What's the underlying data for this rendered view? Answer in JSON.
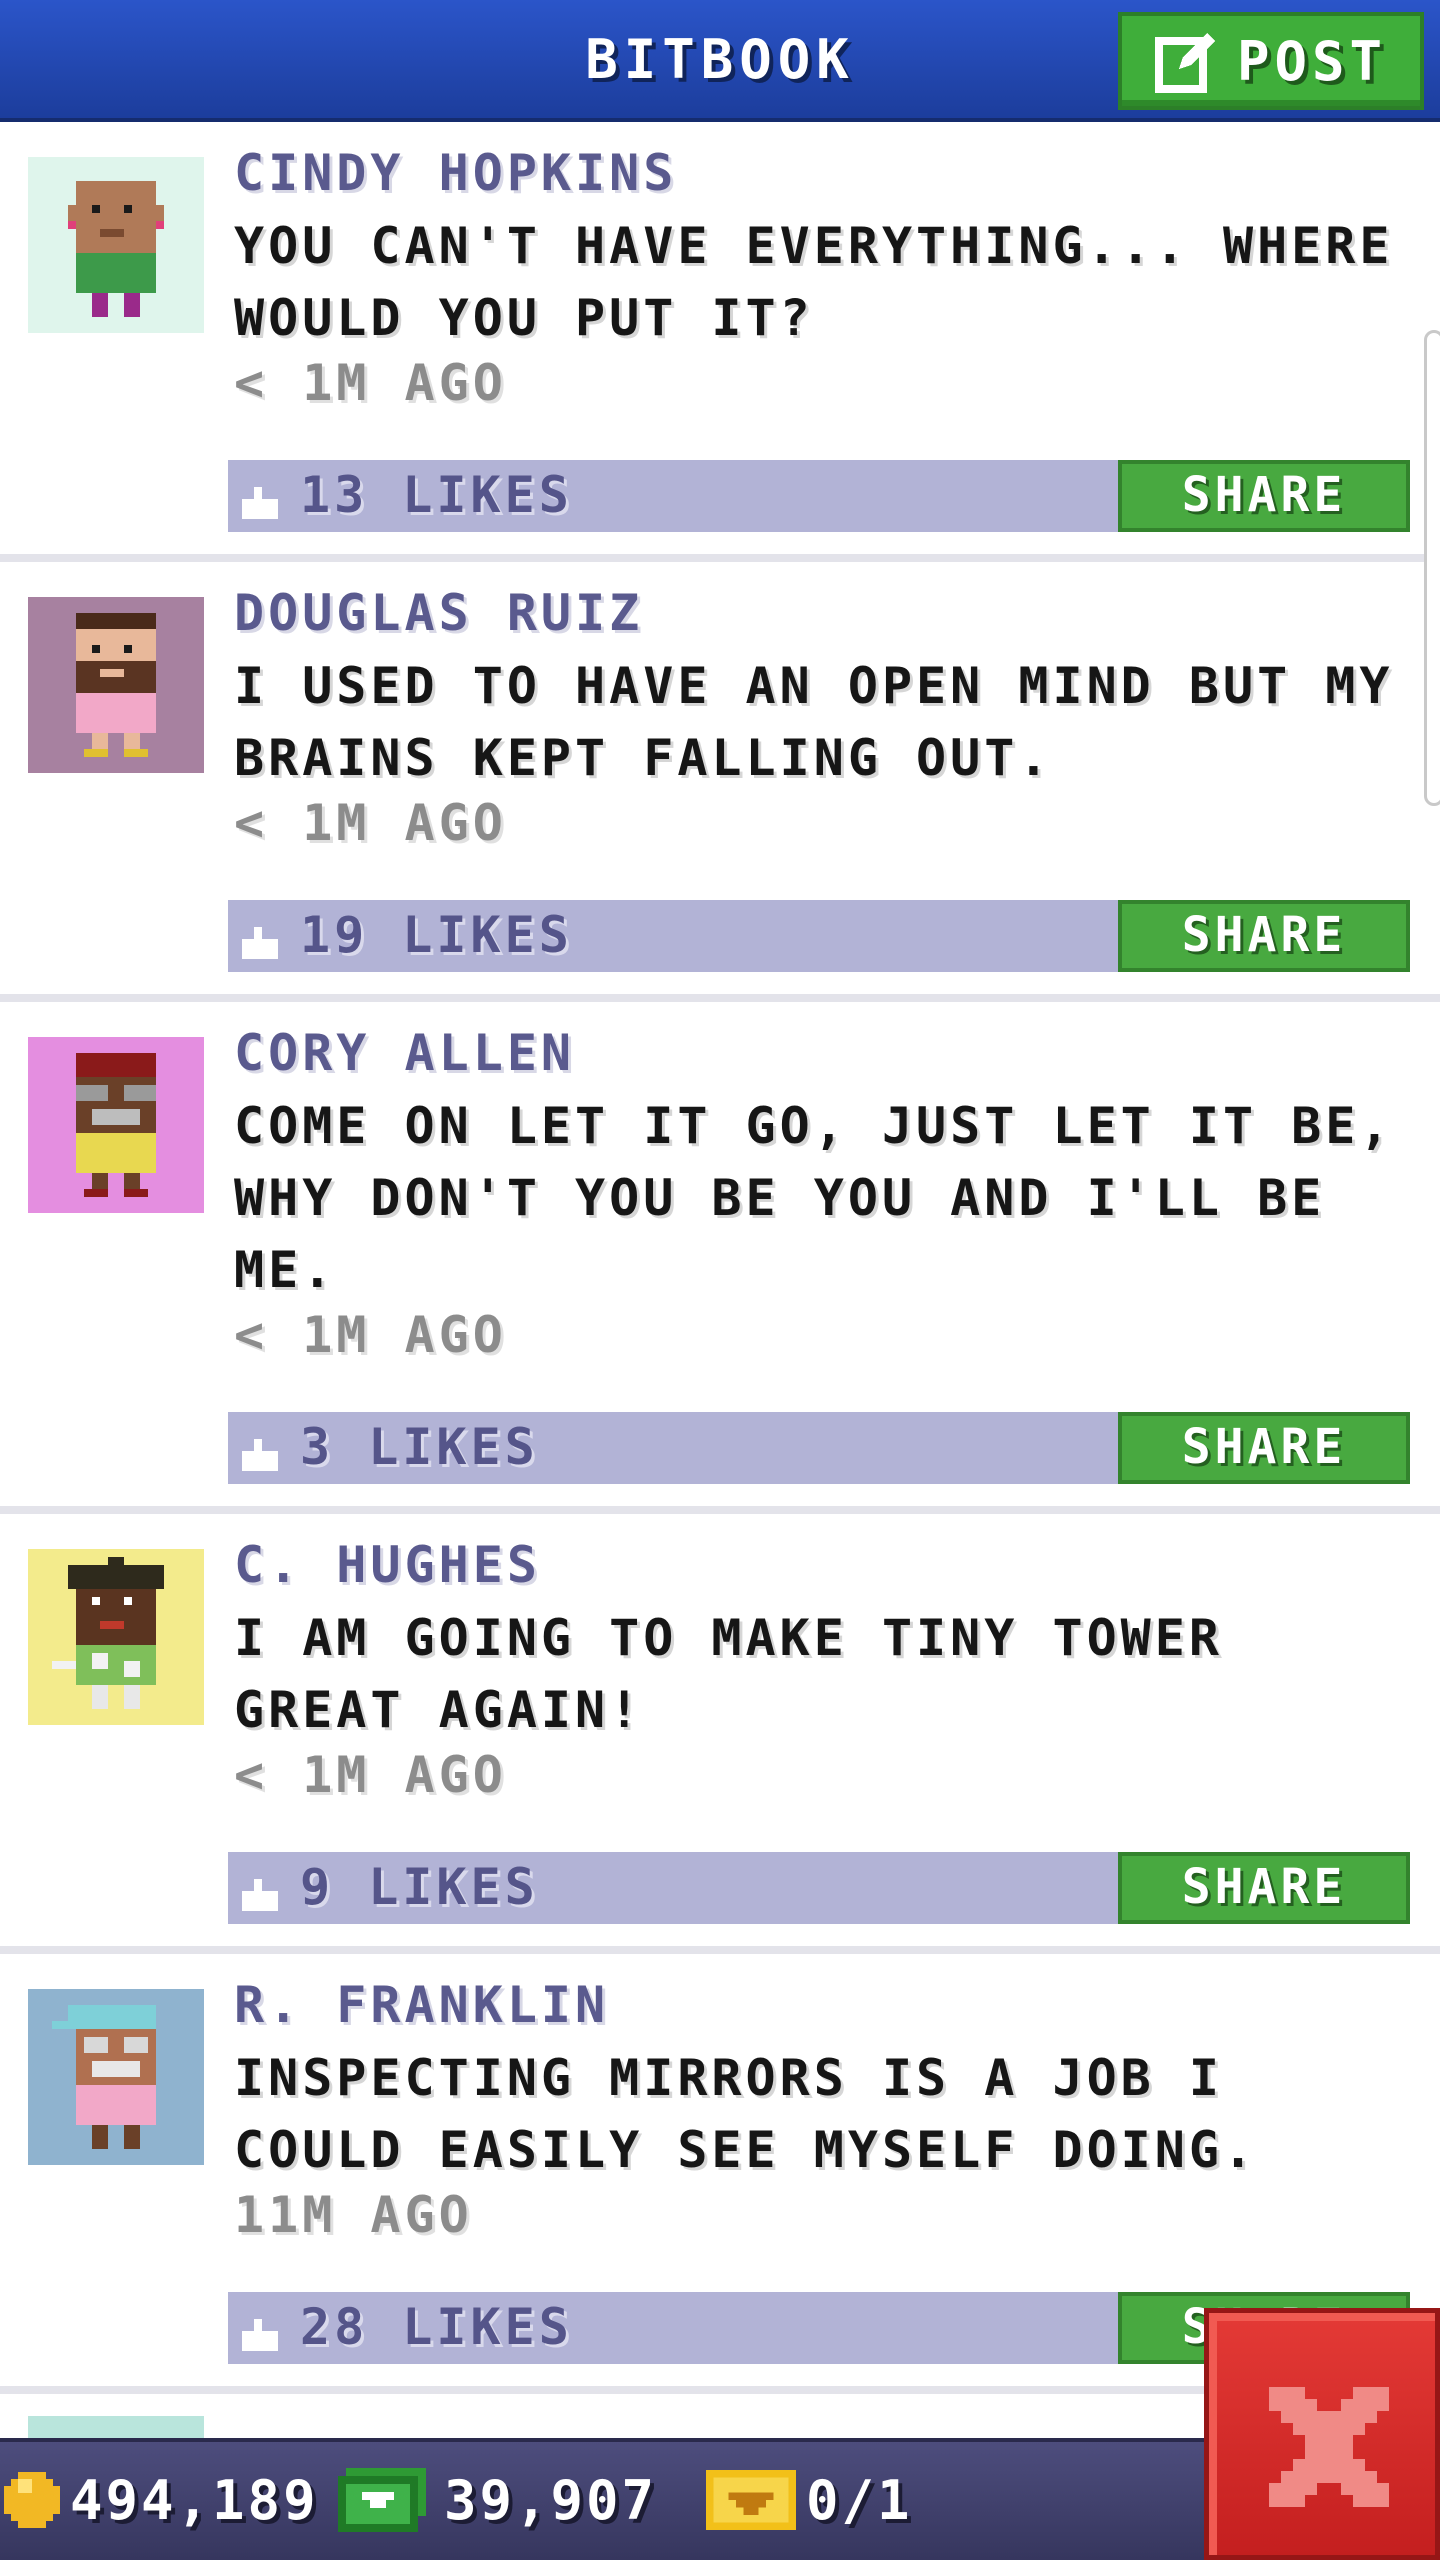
{
  "header": {
    "title": "BITBOOK",
    "post_label": "POST"
  },
  "posts": [
    {
      "author": "CINDY HOPKINS",
      "text": "YOU CAN'T HAVE EVERYTHING... WHERE WOULD YOU PUT IT?",
      "time": "< 1M AGO",
      "likes": "13 LIKES",
      "share": "SHARE",
      "avatar_bg": "#dff5ec"
    },
    {
      "author": "DOUGLAS RUIZ",
      "text": "I USED TO HAVE AN OPEN MIND BUT MY BRAINS KEPT FALLING OUT.",
      "time": "< 1M AGO",
      "likes": "19 LIKES",
      "share": "SHARE",
      "avatar_bg": "#a781a0"
    },
    {
      "author": "CORY ALLEN",
      "text": "COME ON LET IT GO, JUST LET IT BE, WHY DON'T YOU BE YOU AND I'LL BE ME.",
      "time": "< 1M AGO",
      "likes": "3 LIKES",
      "share": "SHARE",
      "avatar_bg": "#e48ee0"
    },
    {
      "author": "C. HUGHES",
      "text": "I AM GOING TO MAKE TINY TOWER GREAT AGAIN!",
      "time": "< 1M AGO",
      "likes": "9 LIKES",
      "share": "SHARE",
      "avatar_bg": "#f3eb8c"
    },
    {
      "author": "R. FRANKLIN",
      "text": "INSPECTING MIRRORS IS A JOB I COULD EASILY SEE MYSELF DOING.",
      "time": "11M AGO",
      "likes": "28 LIKES",
      "share": "SHARE",
      "avatar_bg": "#8fb3cf"
    }
  ],
  "status_bar": {
    "coins": "494,189",
    "bux": "39,907",
    "tickets": "0/1"
  },
  "colors": {
    "header_blue": "#2449b4",
    "share_green": "#48a940",
    "likes_bar": "#b2b3d6",
    "close_red": "#d42a27"
  },
  "icons": {
    "post": "edit-icon",
    "like": "thumbs-up-icon",
    "coin": "coin-icon",
    "bux": "bux-icon",
    "ticket": "ticket-icon",
    "close": "close-icon"
  }
}
